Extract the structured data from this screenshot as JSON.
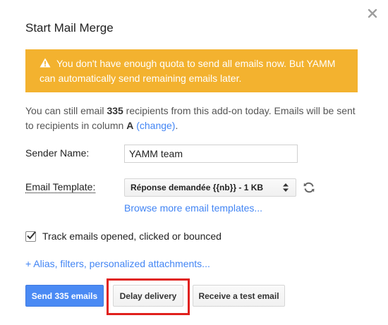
{
  "dialog": {
    "title": "Start Mail Merge",
    "close_icon": "close-icon"
  },
  "warning": {
    "icon": "warning-icon",
    "text": "You don't have enough quota to send all emails now. But YAMM can automatically send remaining emails later.",
    "color": "#f3b22f"
  },
  "info": {
    "prefix": "You can still email ",
    "count": "335",
    "middle": " recipients from this add-on today. Emails will be sent to recipients in column ",
    "column": "A",
    "change_link": "(change)",
    "suffix": "."
  },
  "sender": {
    "label": "Sender Name:",
    "value": "YAMM team"
  },
  "template": {
    "label": "Email Template:",
    "selected": "Réponse demandée {{nb}} - 1 KB",
    "refresh_icon": "refresh-icon",
    "browse_link": "Browse more email templates..."
  },
  "tracking": {
    "checked": true,
    "label": "Track emails opened, clicked or bounced"
  },
  "options_link": "+ Alias, filters, personalized attachments...",
  "buttons": {
    "send": "Send 335 emails",
    "delay": "Delay delivery",
    "test": "Receive a test email"
  },
  "colors": {
    "accent": "#4285f4",
    "primary_button": "#4a8af4",
    "highlight": "#e0201c"
  }
}
